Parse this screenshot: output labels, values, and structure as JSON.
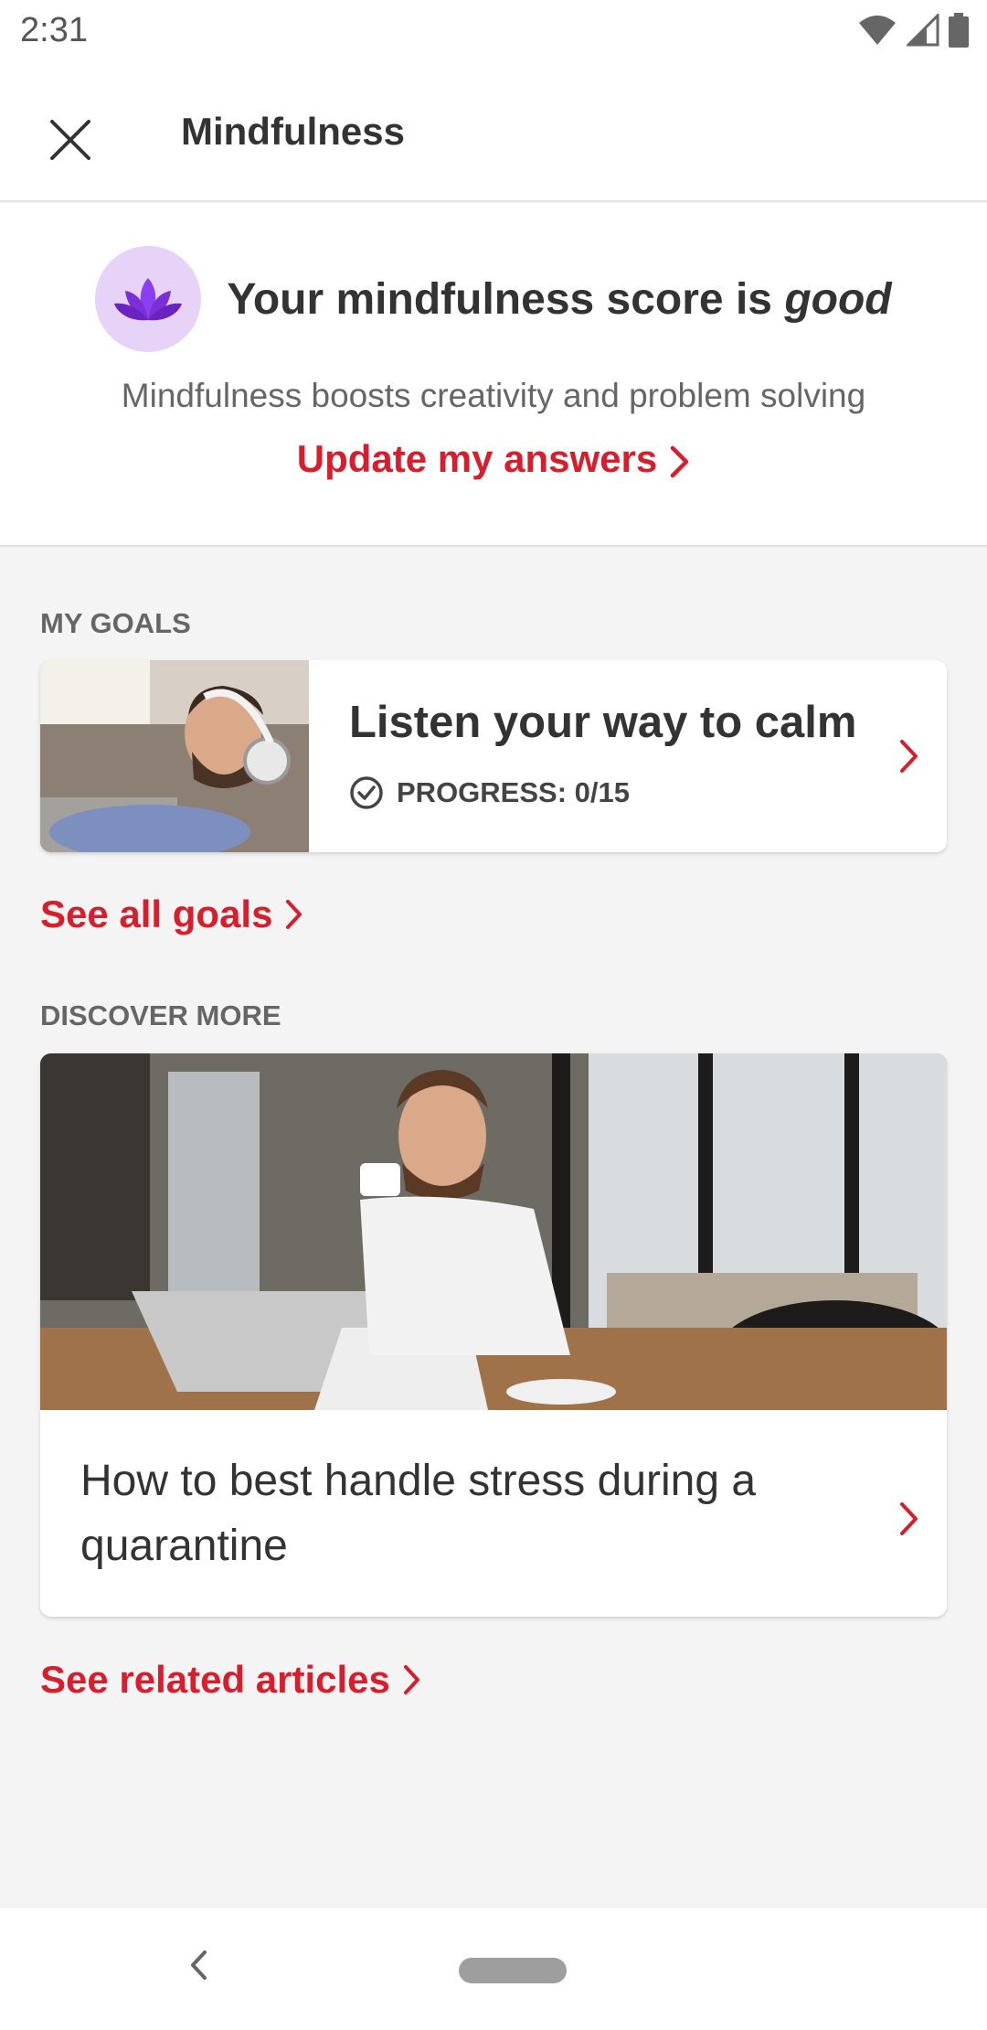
{
  "status_bar": {
    "time": "2:31"
  },
  "app_bar": {
    "title": "Mindfulness"
  },
  "score": {
    "headline_prefix": "Your mindfulness score is ",
    "headline_rating": "good",
    "subtitle": "Mindfulness boosts creativity and problem solving",
    "update_link": "Update my answers"
  },
  "goals": {
    "section_label": "MY GOALS",
    "items": [
      {
        "title": "Listen your way to calm",
        "progress": "PROGRESS: 0/15"
      }
    ],
    "see_all": "See all goals"
  },
  "discover": {
    "section_label": "DISCOVER MORE",
    "article_title": "How to best handle stress during a quarantine",
    "see_related": "See related articles"
  },
  "colors": {
    "accent": "#d81e2c",
    "lotus_bg": "#e6d3f7",
    "lotus": "#7b2fd6"
  }
}
